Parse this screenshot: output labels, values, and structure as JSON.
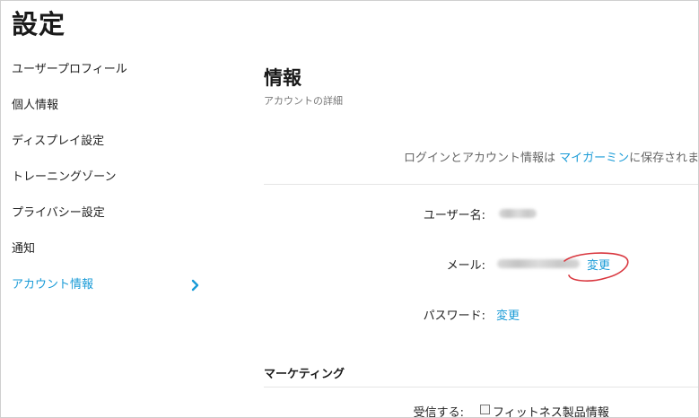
{
  "page": {
    "title": "設定"
  },
  "sidebar": {
    "items": [
      {
        "label": "ユーザープロフィール"
      },
      {
        "label": "個人情報"
      },
      {
        "label": "ディスプレイ設定"
      },
      {
        "label": "トレーニングゾーン"
      },
      {
        "label": "プライバシー設定"
      },
      {
        "label": "通知"
      },
      {
        "label": "アカウント情報",
        "active": true
      }
    ]
  },
  "section": {
    "title": "情報",
    "subtitle": "アカウントの詳細",
    "notice_prefix": "ログインとアカウント情報は ",
    "notice_link": "マイガーミン",
    "notice_suffix": "に保存されます"
  },
  "fields": {
    "username_label": "ユーザー名:",
    "email_label": "メール:",
    "email_change": "変更",
    "password_label": "パスワード:",
    "password_change": "変更"
  },
  "marketing": {
    "title": "マーケティング",
    "receive_label": "受信する:",
    "option_label": "フィットネス製品情報",
    "option_checked": false
  },
  "colors": {
    "accent": "#1a9bd7",
    "annotation": "#d9363e"
  },
  "icons": {
    "active_item": "chevron-right-icon"
  }
}
